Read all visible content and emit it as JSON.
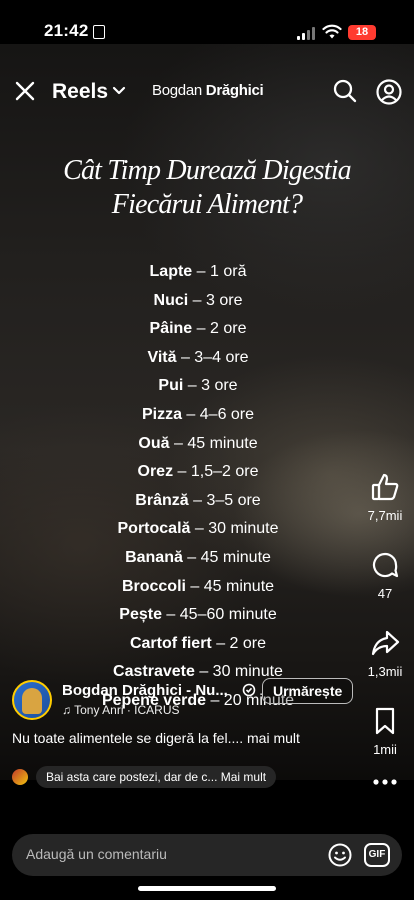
{
  "status_bar": {
    "time": "21:42",
    "battery": "18"
  },
  "nav": {
    "title": "Reels",
    "account_first": "Bogdan ",
    "account_second": "Drăghici"
  },
  "post": {
    "heading_line1": "Cât Timp Durează Digestia",
    "heading_line2": "Fiecărui Aliment?",
    "foods": [
      {
        "name": "Lapte",
        "time": "1 oră"
      },
      {
        "name": "Nuci",
        "time": "3 ore"
      },
      {
        "name": "Pâine",
        "time": "2 ore"
      },
      {
        "name": "Vită",
        "time": "3–4 ore"
      },
      {
        "name": "Pui",
        "time": "3 ore"
      },
      {
        "name": "Pizza",
        "time": "4–6 ore"
      },
      {
        "name": "Ouă",
        "time": "45 minute"
      },
      {
        "name": "Orez",
        "time": "1,5–2 ore"
      },
      {
        "name": "Brânză",
        "time": "3–5 ore"
      },
      {
        "name": "Portocală",
        "time": "30 minute"
      },
      {
        "name": "Banană",
        "time": "45 minute"
      },
      {
        "name": "Broccoli",
        "time": "45 minute"
      },
      {
        "name": "Pește",
        "time": "45–60 minute"
      },
      {
        "name": "Cartof fiert",
        "time": "2 ore"
      },
      {
        "name": "Castravete",
        "time": "30 minute"
      },
      {
        "name": "Pepene verde",
        "time": "20 minute"
      }
    ]
  },
  "actions": {
    "likes": "7,7mii",
    "comments": "47",
    "shares": "1,3mii",
    "saves": "1mii"
  },
  "author": {
    "name": "Bogdan Drăghici - Nu...",
    "music": "Tony Anri · ICARUS",
    "follow_label": "Urmărește"
  },
  "caption": "Nu toate alimentele se digeră la fel.... mai mult",
  "top_comment": "Bai asta care postezi, dar de c...  Mai mult",
  "comment_input": {
    "placeholder": "Adaugă un comentariu",
    "gif_label": "GIF"
  }
}
